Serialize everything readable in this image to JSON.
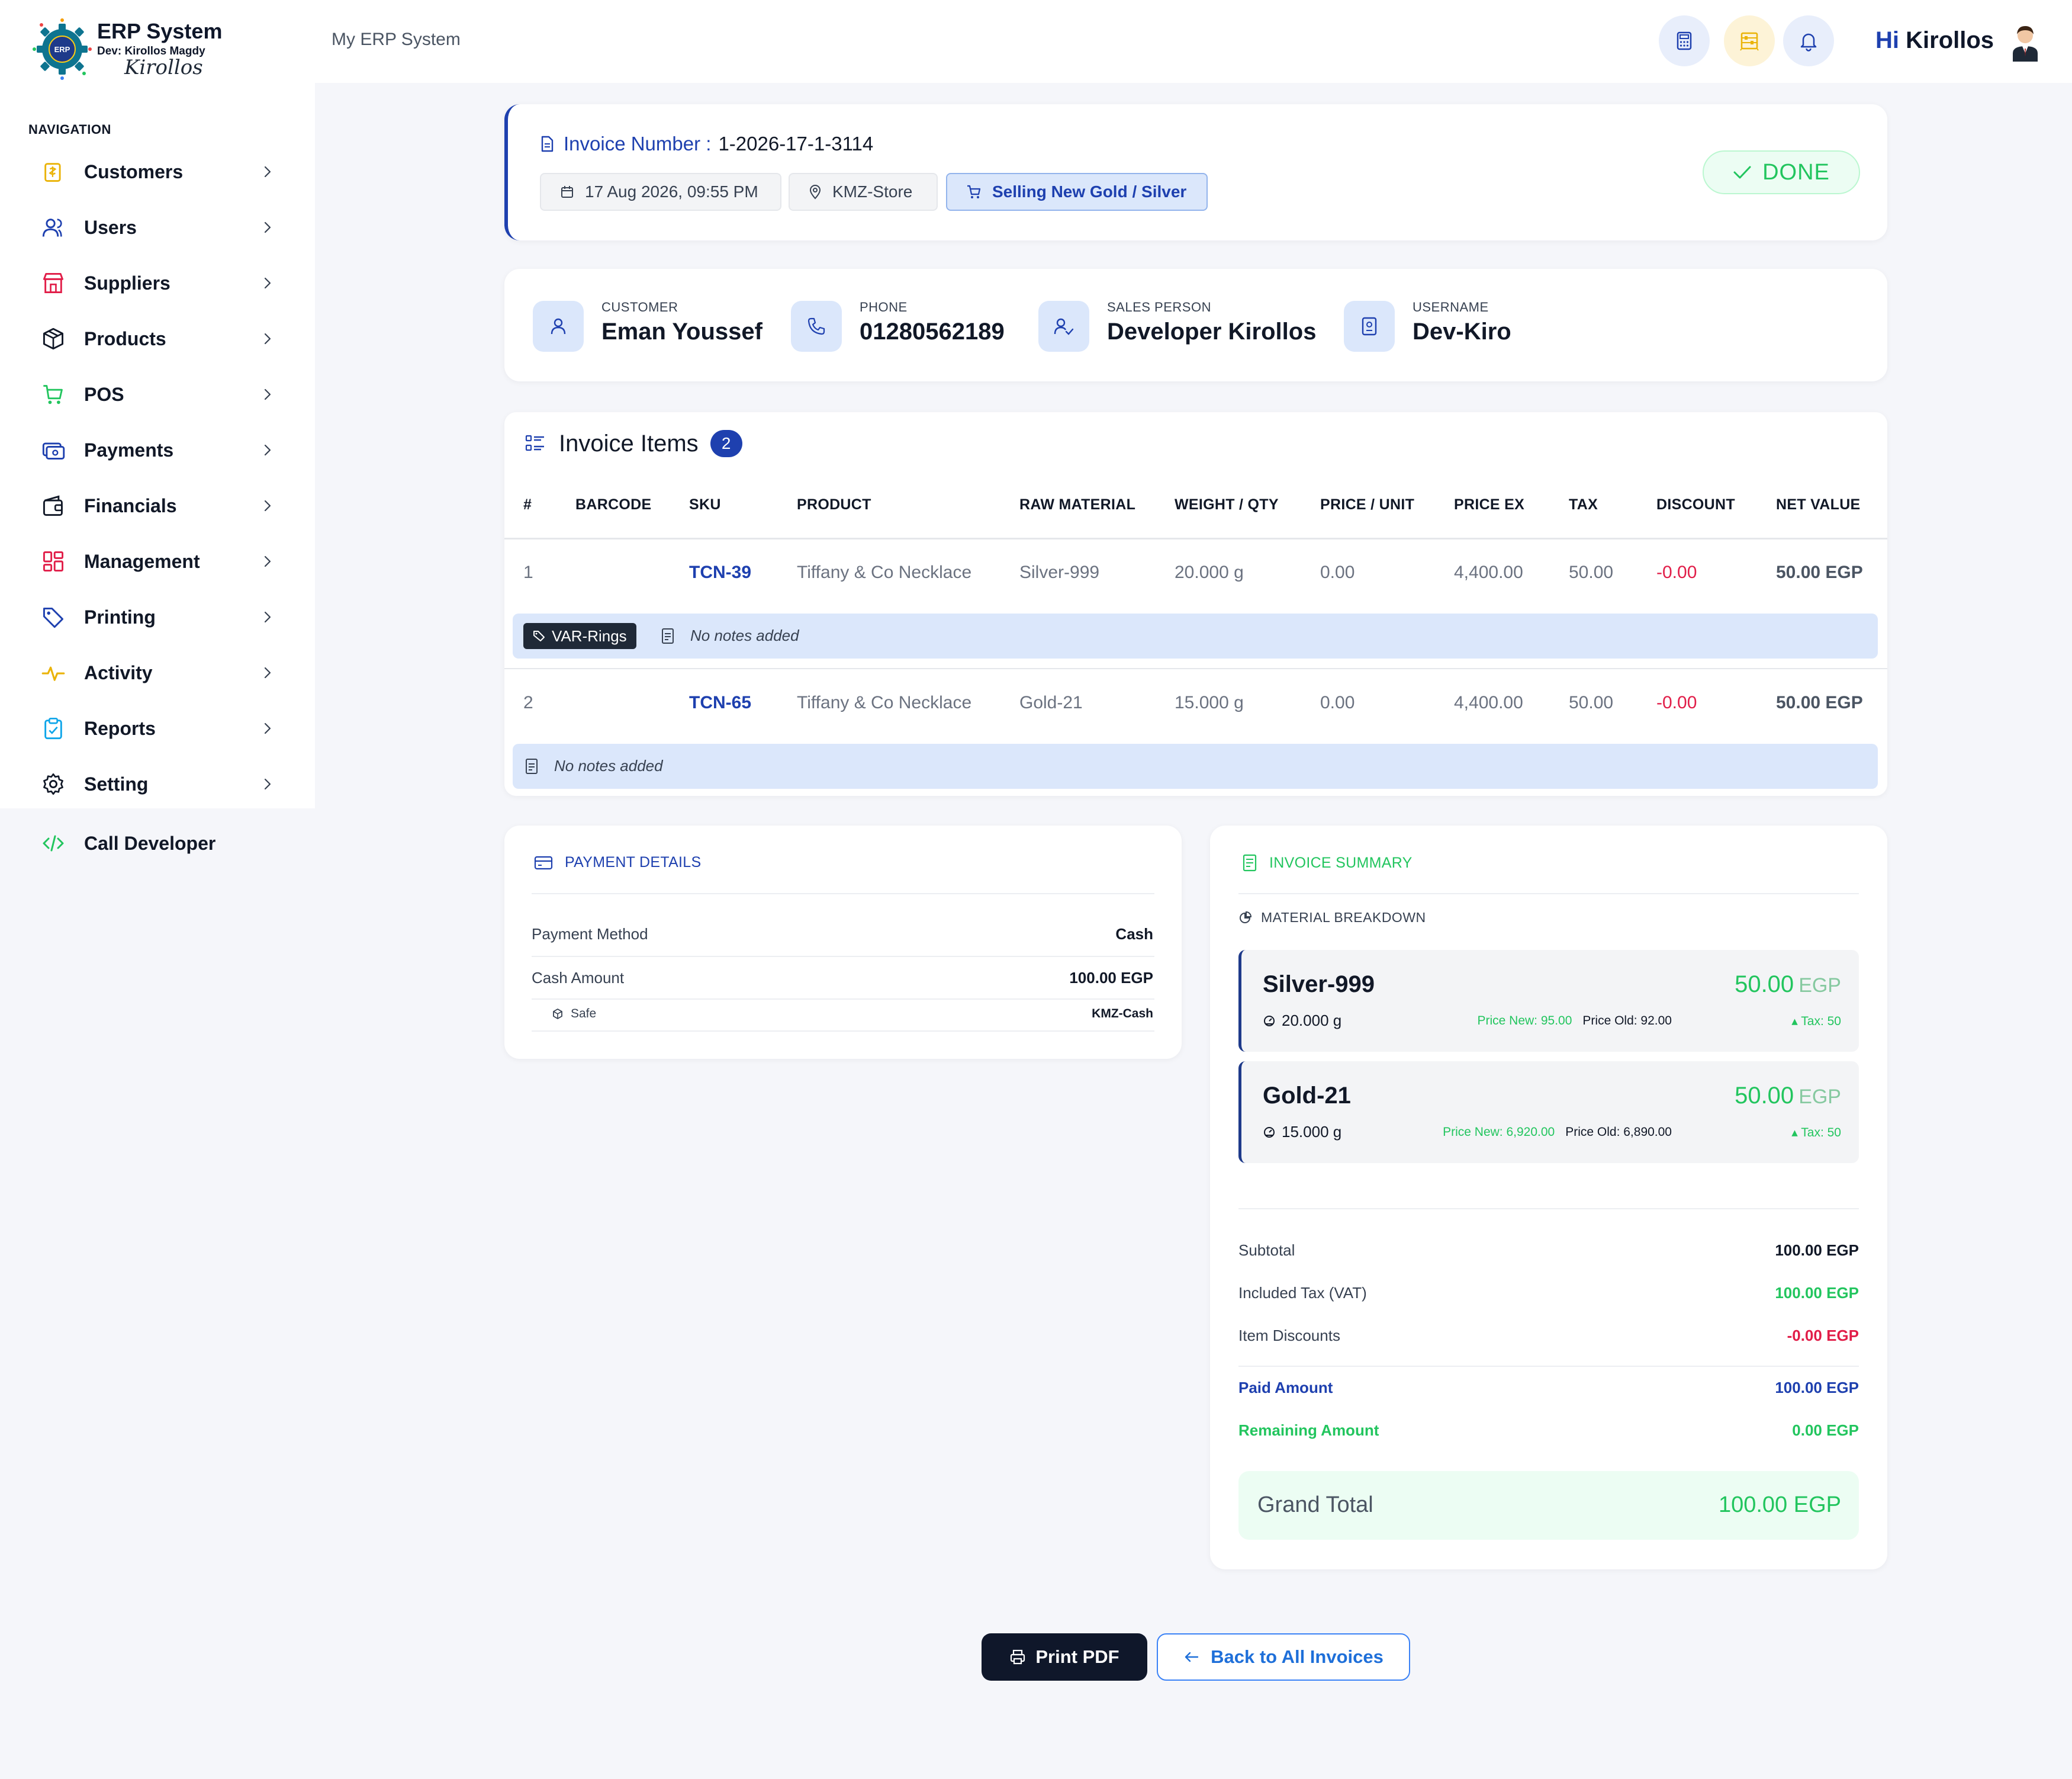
{
  "app": {
    "name": "ERP System",
    "dev_line": "Dev: Kirollos Magdy",
    "signature": "Kirollos",
    "logo_text": "ERP"
  },
  "nav": {
    "heading": "NAVIGATION",
    "items": [
      {
        "label": "Customers",
        "icon": "customers-icon",
        "color": "#eab308"
      },
      {
        "label": "Users",
        "icon": "users-icon",
        "color": "#1e40af"
      },
      {
        "label": "Suppliers",
        "icon": "store-icon",
        "color": "#e11d48"
      },
      {
        "label": "Products",
        "icon": "box-icon",
        "color": "#111827"
      },
      {
        "label": "POS",
        "icon": "cart-icon",
        "color": "#22c55e"
      },
      {
        "label": "Payments",
        "icon": "payments-icon",
        "color": "#1e40af"
      },
      {
        "label": "Financials",
        "icon": "wallet-icon",
        "color": "#111827"
      },
      {
        "label": "Management",
        "icon": "grid-icon",
        "color": "#e11d48"
      },
      {
        "label": "Printing",
        "icon": "tag-icon",
        "color": "#1e40af"
      },
      {
        "label": "Activity",
        "icon": "activity-icon",
        "color": "#eab308"
      },
      {
        "label": "Reports",
        "icon": "clipboard-icon",
        "color": "#0ea5e9"
      },
      {
        "label": "Setting",
        "icon": "gear-icon",
        "color": "#111827"
      }
    ],
    "call_developer": "Call Developer"
  },
  "topbar": {
    "breadcrumb": "My ERP System",
    "greeting_hi": "Hi",
    "greeting_name": "Kirollos"
  },
  "invoice": {
    "number_label": "Invoice Number :",
    "number": "1-2026-17-1-3114",
    "date": "17 Aug 2026, 09:55 PM",
    "store": "KMZ-Store",
    "type": "Selling New Gold / Silver",
    "status": "DONE"
  },
  "info": {
    "customer_label": "CUSTOMER",
    "customer": "Eman Youssef",
    "phone_label": "PHONE",
    "phone": "01280562189",
    "sales_label": "SALES PERSON",
    "sales": "Developer Kirollos",
    "username_label": "USERNAME",
    "username": "Dev-Kiro"
  },
  "items": {
    "title": "Invoice Items",
    "count": "2",
    "headers": [
      "#",
      "BARCODE",
      "SKU",
      "PRODUCT",
      "RAW MATERIAL",
      "WEIGHT / QTY",
      "PRICE / UNIT",
      "PRICE EX",
      "TAX",
      "DISCOUNT",
      "NET VALUE"
    ],
    "rows": [
      {
        "no": "1",
        "barcode": "",
        "sku": "TCN-39",
        "product": "Tiffany & Co Necklace",
        "material": "Silver-999",
        "weight": "20.000 g",
        "price_unit": "0.00",
        "price_ex": "4,400.00",
        "tax": "50.00",
        "discount": "-0.00",
        "net": "50.00 EGP",
        "variant": "VAR-Rings",
        "note": "No notes added"
      },
      {
        "no": "2",
        "barcode": "",
        "sku": "TCN-65",
        "product": "Tiffany & Co Necklace",
        "material": "Gold-21",
        "weight": "15.000 g",
        "price_unit": "0.00",
        "price_ex": "4,400.00",
        "tax": "50.00",
        "discount": "-0.00",
        "net": "50.00 EGP",
        "variant": "",
        "note": "No notes added"
      }
    ]
  },
  "payment": {
    "title": "PAYMENT DETAILS",
    "method_label": "Payment Method",
    "method": "Cash",
    "cash_label": "Cash Amount",
    "cash": "100.00 EGP",
    "safe_label": "Safe",
    "safe": "KMZ-Cash"
  },
  "summary": {
    "title": "INVOICE SUMMARY",
    "breakdown_title": "MATERIAL BREAKDOWN",
    "materials": [
      {
        "name": "Silver-999",
        "total": "50.00",
        "currency": "EGP",
        "weight": "20.000 g",
        "price_new": "Price New: 95.00",
        "price_old": "Price Old: 92.00",
        "tax": "Tax: 50"
      },
      {
        "name": "Gold-21",
        "total": "50.00",
        "currency": "EGP",
        "weight": "15.000 g",
        "price_new": "Price New: 6,920.00",
        "price_old": "Price Old: 6,890.00",
        "tax": "Tax: 50"
      }
    ],
    "subtotal_label": "Subtotal",
    "subtotal": "100.00 EGP",
    "vat_label": "Included Tax (VAT)",
    "vat": "100.00 EGP",
    "discounts_label": "Item Discounts",
    "discounts": "-0.00 EGP",
    "paid_label": "Paid Amount",
    "paid": "100.00 EGP",
    "remaining_label": "Remaining Amount",
    "remaining": "0.00 EGP",
    "grand_label": "Grand Total",
    "grand": "100.00 EGP"
  },
  "actions": {
    "print": "Print PDF",
    "back": "Back to All Invoices"
  },
  "colors": {
    "primary": "#1e40af",
    "success": "#22c55e",
    "danger": "#e11d48",
    "dark": "#0f172a"
  }
}
